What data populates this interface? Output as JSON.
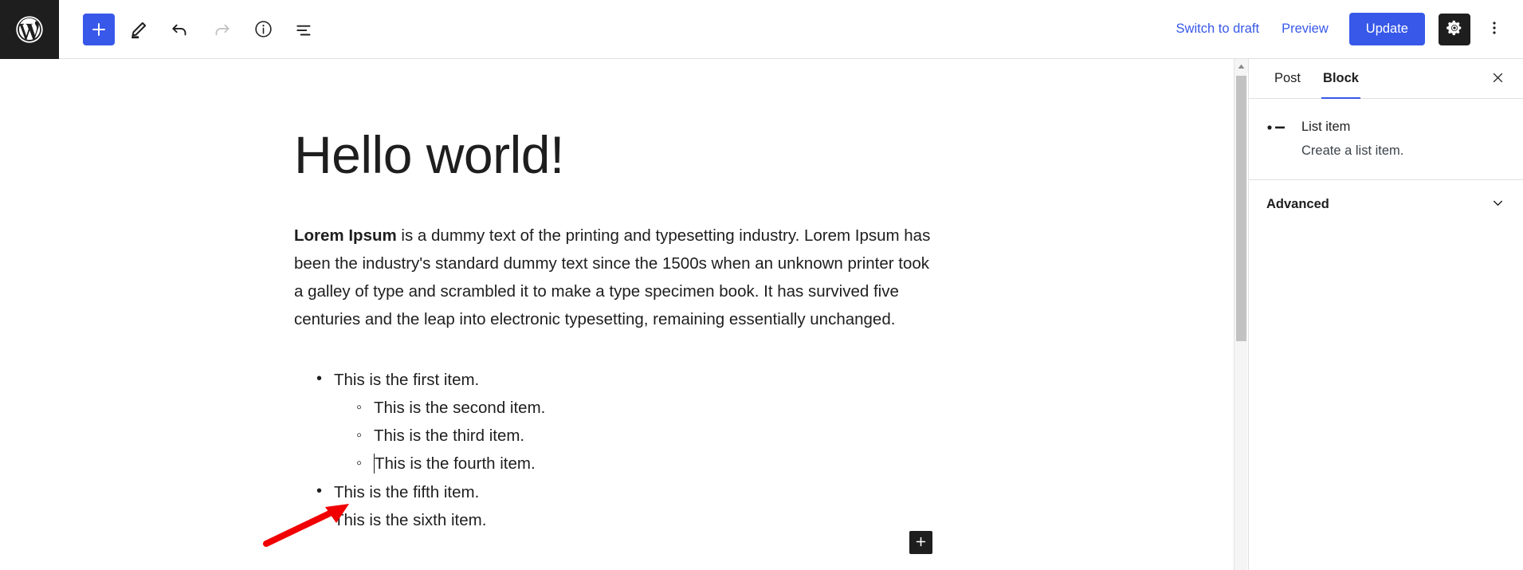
{
  "topbar": {
    "logo_icon": "wordpress-logo-icon",
    "tools": [
      {
        "name": "add-block-button",
        "icon": "plus-icon",
        "label": "Add block"
      },
      {
        "name": "edit-tools-button",
        "icon": "pencil-icon",
        "label": "Tools"
      },
      {
        "name": "undo-button",
        "icon": "undo-arrow-icon",
        "label": "Undo"
      },
      {
        "name": "redo-button",
        "icon": "redo-arrow-icon",
        "label": "Redo",
        "disabled": true
      },
      {
        "name": "details-button",
        "icon": "info-circle-icon",
        "label": "Details"
      },
      {
        "name": "list-view-button",
        "icon": "list-view-icon",
        "label": "List View"
      }
    ],
    "switch_to_draft_label": "Switch to draft",
    "preview_label": "Preview",
    "update_label": "Update",
    "settings_icon": "gear-icon",
    "options_icon": "kebab-menu-icon"
  },
  "editor": {
    "title": "Hello world!",
    "paragraph_bold_lead": "Lorem Ipsum",
    "paragraph_rest": " is a dummy text of the printing and typesetting industry. Lorem Ipsum has been the industry's standard dummy text since the 1500s when an unknown printer took a galley of type and scrambled it to make a type specimen book. It has survived five centuries and the leap into electronic typesetting, remaining essentially unchanged.",
    "list_items": [
      {
        "text": "This is the first item.",
        "level": 1,
        "marker": "disc"
      },
      {
        "text": "This is the second item.",
        "level": 2,
        "marker": "circle"
      },
      {
        "text": "This is the third item.",
        "level": 2,
        "marker": "circle"
      },
      {
        "text": "This is the fourth item.",
        "level": 2,
        "marker": "circle",
        "caret": true
      },
      {
        "text": "This is the fifth item.",
        "level": 1,
        "marker": "disc"
      },
      {
        "text": "This is the sixth item.",
        "level": 1,
        "marker": "disc"
      }
    ],
    "inserter_icon": "plus-icon",
    "annotation_icon": "red-arrow-annotation"
  },
  "scrollbar": {
    "up_arrow_icon": "scroll-up-arrow-icon"
  },
  "sidebar": {
    "tabs": [
      {
        "label": "Post",
        "active": false
      },
      {
        "label": "Block",
        "active": true
      }
    ],
    "close_icon": "close-icon",
    "block": {
      "icon": "list-item-icon",
      "title": "List item",
      "description": "Create a list item."
    },
    "advanced_label": "Advanced",
    "advanced_chevron_icon": "chevron-down-icon"
  },
  "colors": {
    "accent_blue": "#3858e9",
    "dark": "#1e1e1e",
    "annotation_red": "#f00000"
  }
}
